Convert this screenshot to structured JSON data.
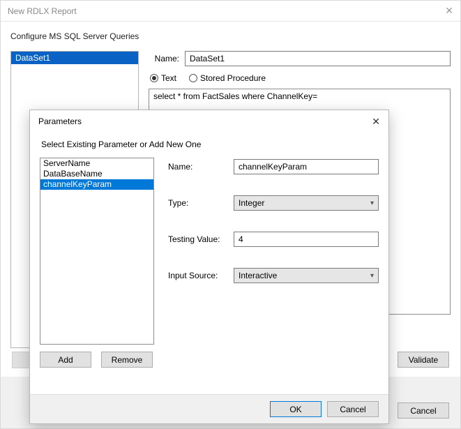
{
  "parent": {
    "title": "New RDLX Report",
    "subtitle": "Configure MS SQL Server Queries",
    "datasets": [
      "DataSet1"
    ],
    "name_label": "Name:",
    "name_value": "DataSet1",
    "mode": {
      "text": "Text",
      "sp": "Stored Procedure"
    },
    "query": "select * from FactSales where ChannelKey=",
    "validate": "Validate",
    "cancel": "Cancel"
  },
  "dialog": {
    "title": "Parameters",
    "subtitle": "Select Existing Parameter or Add New One",
    "params": [
      "ServerName",
      "DataBaseName",
      "channelKeyParam"
    ],
    "selected_index": 2,
    "labels": {
      "name": "Name:",
      "type": "Type:",
      "testing": "Testing Value:",
      "source": "Input Source:"
    },
    "values": {
      "name": "channelKeyParam",
      "type": "Integer",
      "testing": "4",
      "source": "Interactive"
    },
    "buttons": {
      "add": "Add",
      "remove": "Remove",
      "ok": "OK",
      "cancel": "Cancel"
    }
  }
}
